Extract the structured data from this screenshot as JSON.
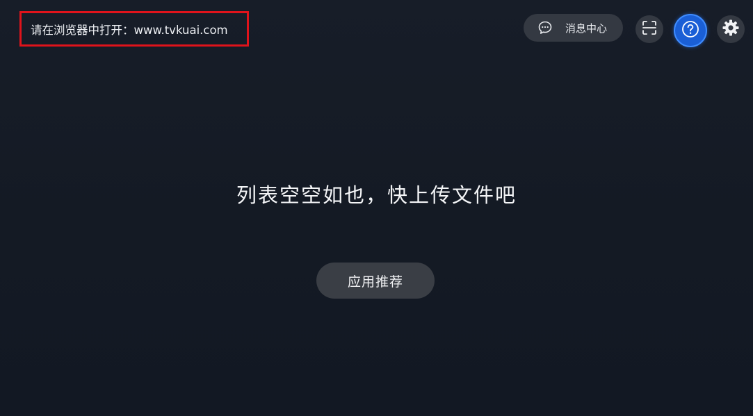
{
  "header": {
    "open_in_browser_hint": "请在浏览器中打开：www.tvkuai.com",
    "message_center_label": "消息中心"
  },
  "icons": {
    "message": "chat-bubble-icon",
    "scan": "scan-frame-icon",
    "help": "question-circle-icon",
    "settings": "gear-icon"
  },
  "main": {
    "empty_message": "列表空空如也，快上传文件吧",
    "recommend_button_label": "应用推荐"
  },
  "colors": {
    "background": "#151b26",
    "highlight_border": "#e0131b",
    "help_accent": "#1a5fd6",
    "button_bg": "#343942"
  }
}
